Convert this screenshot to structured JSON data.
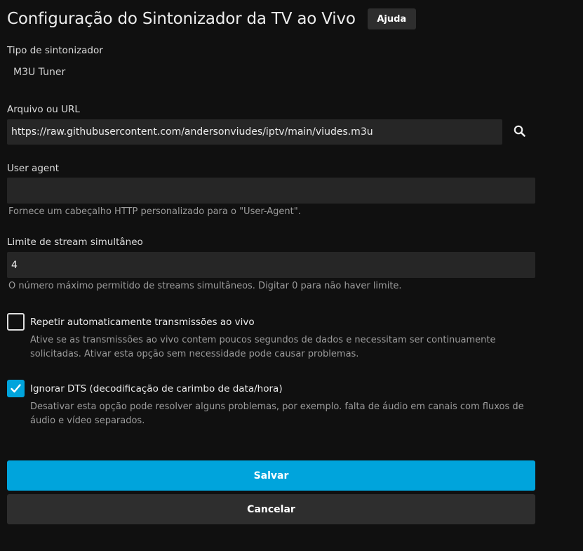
{
  "header": {
    "title": "Configuração do Sintonizador da TV ao Vivo",
    "help_label": "Ajuda"
  },
  "tuner_type": {
    "label": "Tipo de sintonizador",
    "value": "M3U Tuner"
  },
  "file_url": {
    "label": "Arquivo ou URL",
    "value": "https://raw.githubusercontent.com/andersonviudes/iptv/main/viudes.m3u",
    "search_icon": "search-icon"
  },
  "user_agent": {
    "label": "User agent",
    "value": "",
    "hint": "Fornece um cabeçalho HTTP personalizado para o \"User-Agent\"."
  },
  "stream_limit": {
    "label": "Limite de stream simultâneo",
    "value": "4",
    "hint": "O número máximo permitido de streams simultâneos. Digitar 0 para não haver limite."
  },
  "auto_loop": {
    "label": "Repetir automaticamente transmissões ao vivo",
    "checked": false,
    "description": "Ative se as transmissões ao vivo contem poucos segundos de dados e necessitam ser continuamente solicitadas. Ativar esta opção sem necessidade pode causar problemas."
  },
  "ignore_dts": {
    "label": "Ignorar DTS (decodificação de carimbo de data/hora)",
    "checked": true,
    "description": "Desativar esta opção pode resolver alguns problemas, por exemplo. falta de áudio em canais com fluxos de áudio e vídeo separados."
  },
  "buttons": {
    "save_label": "Salvar",
    "cancel_label": "Cancelar"
  },
  "colors": {
    "accent": "#00a4dc",
    "background": "#101010",
    "input_background": "#262626"
  }
}
